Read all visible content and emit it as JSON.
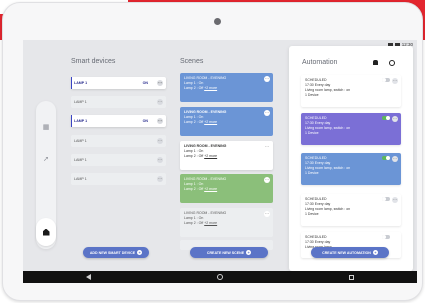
{
  "status_bar": {
    "time": "12:30"
  },
  "sections": {
    "devices_title": "Smart devices",
    "scenes_title": "Scenes",
    "automation_title": "Automation"
  },
  "devices": [
    {
      "label": "LAMP 1",
      "state": "ON",
      "active": true
    },
    {
      "label": "LAMP 1",
      "state": "",
      "active": false
    },
    {
      "label": "LAMP 1",
      "state": "ON",
      "active": true
    },
    {
      "label": "LAMP 1",
      "state": "",
      "active": false
    },
    {
      "label": "LAMP 1",
      "state": "",
      "active": false
    },
    {
      "label": "LAMP 1",
      "state": "",
      "active": false
    }
  ],
  "scenes": [
    {
      "title": "LIVING ROOM - EVENING",
      "line1": "Lamp 1 : On",
      "line2": "Lamp 2 : Off",
      "more": "+2 more"
    },
    {
      "title": "LIVING ROOM - EVENING",
      "line1": "Lamp 1 : On",
      "line2": "Lamp 2 : Off",
      "more": "+2 more"
    },
    {
      "title": "LIVING ROOM - EVENING",
      "line1": "Lamp 1 : On",
      "line2": "Lamp 2 : Off",
      "more": "+2 more"
    },
    {
      "title": "LIVING ROOM - EVENING",
      "line1": "Lamp 1 : On",
      "line2": "Lamp 2 : Off",
      "more": "+2 more"
    },
    {
      "title": "LIVING ROOM - EVENING",
      "line1": "Lamp 1 : On",
      "line2": "Lamp 2 : Off",
      "more": "+2 more"
    }
  ],
  "rules": [
    {
      "title": "SCHEDULED",
      "line1": "17:30 Every day",
      "line2": "Living room lamp, switch : on",
      "line3": "1 Device",
      "enabled": false
    },
    {
      "title": "SCHEDULED",
      "line1": "17:30 Every day",
      "line2": "Living room lamp, switch : on",
      "line3": "1 Device",
      "enabled": true
    },
    {
      "title": "SCHEDULED",
      "line1": "17:30 Every day",
      "line2": "Living room lamp, switch : on",
      "line3": "1 Device",
      "enabled": true
    },
    {
      "title": "SCHEDULED",
      "line1": "17:30 Every day",
      "line2": "Living room lamp, switch : on",
      "line3": "1 Device",
      "enabled": false
    },
    {
      "title": "SCHEDULED",
      "line1": "17:30 Every day",
      "line2": "Living room lamp",
      "line3": "",
      "enabled": false
    }
  ],
  "buttons": {
    "add_device": "ADD NEW SMART DEVICE",
    "create_scene": "CREATE NEW SCENE",
    "create_automation": "CREATE NEW AUTOMATION"
  },
  "colors": {
    "accent": "#5b74c7",
    "scene_blue": "#6b95d6",
    "scene_green": "#8bbf7a",
    "rule_purple": "#7b6fd6",
    "brand_red": "#e3262f"
  }
}
